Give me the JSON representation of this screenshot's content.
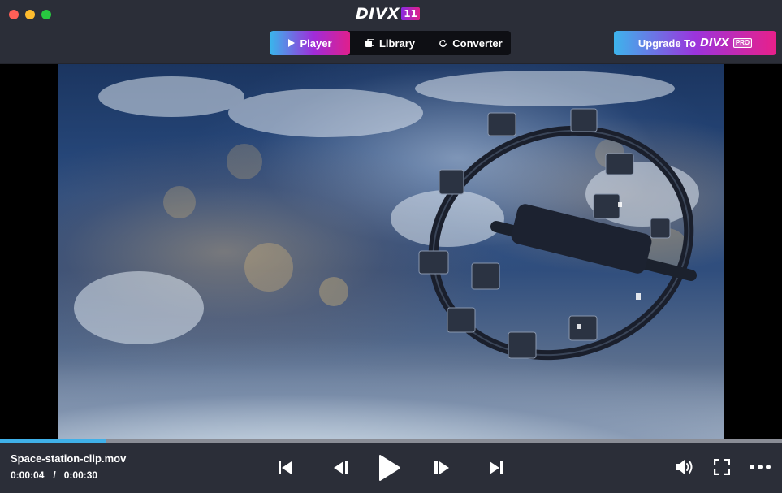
{
  "window": {
    "traffic_lights": [
      "close",
      "minimize",
      "maximize"
    ]
  },
  "logo": {
    "word": "DIVX",
    "badge": "11"
  },
  "tabs": [
    {
      "label": "Player",
      "icon": "play-icon",
      "active": true
    },
    {
      "label": "Library",
      "icon": "library-icon",
      "active": false
    },
    {
      "label": "Converter",
      "icon": "refresh-icon",
      "active": false
    }
  ],
  "upgrade": {
    "label": "Upgrade To",
    "brand": "DIVX",
    "tier": "PRO"
  },
  "video": {
    "description_icon": "video-frame"
  },
  "playback": {
    "filename": "Space-station-clip.mov",
    "current_time": "0:00:04",
    "separator": "/",
    "duration": "0:00:30",
    "progress": 0.135
  },
  "controls": {
    "icons": [
      "skip-to-start-icon",
      "step-back-icon",
      "play-icon",
      "step-forward-icon",
      "skip-to-end-icon",
      "volume-icon",
      "fullscreen-icon",
      "more-icon"
    ]
  },
  "colors": {
    "header_bg": "#2b2e38",
    "accent_blue": "#3fb0e8",
    "accent_purple": "#9b34dc",
    "accent_pink": "#e8208a"
  }
}
